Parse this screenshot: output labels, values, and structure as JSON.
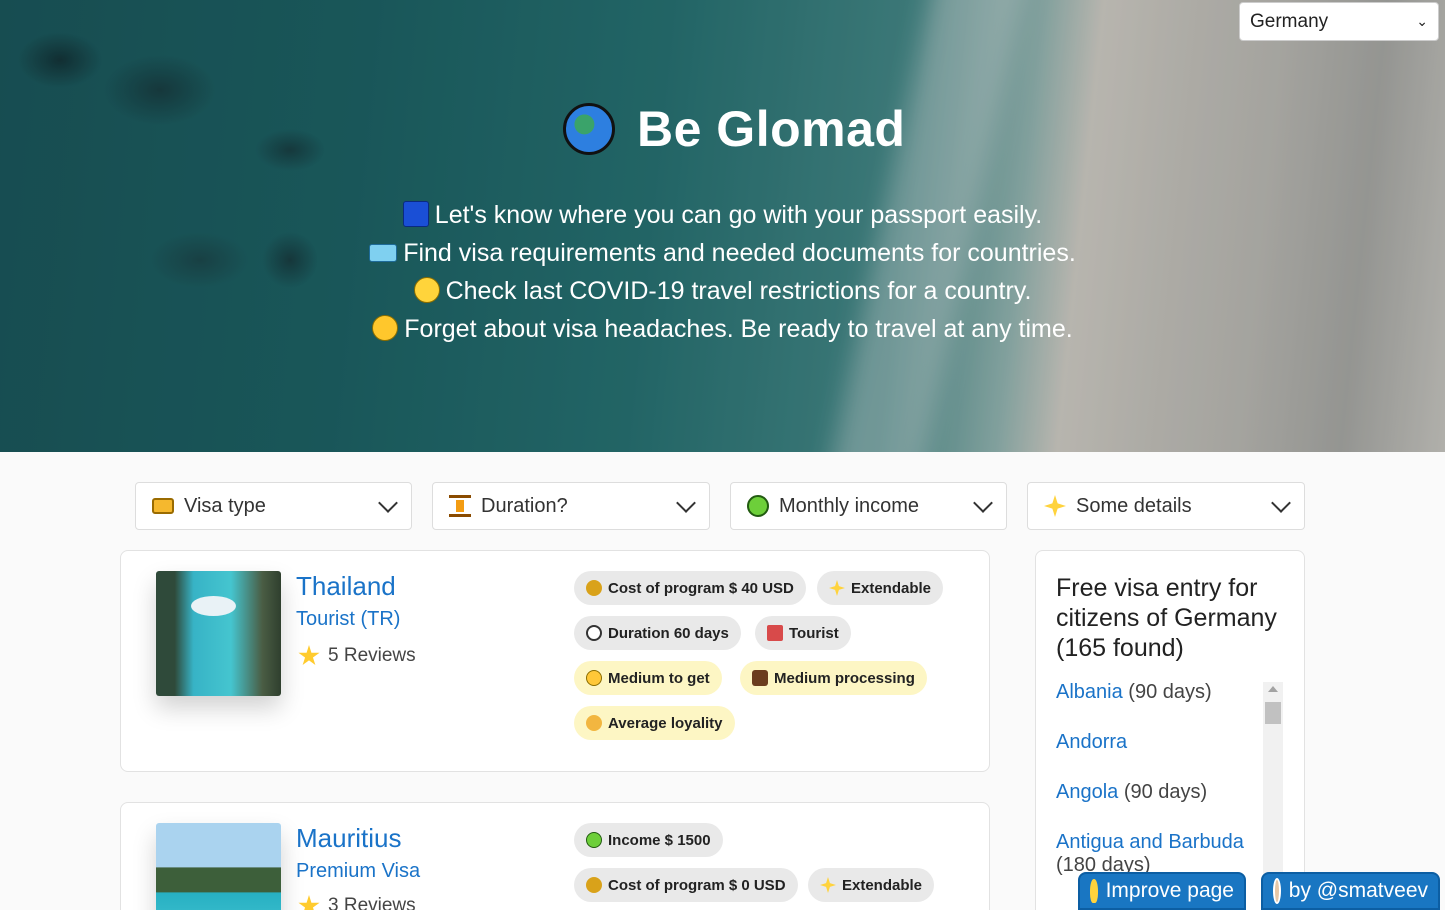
{
  "hero": {
    "title": "Be Glomad",
    "lines": [
      "Let's know where you can go with your passport easily.",
      "Find visa requirements and needed documents for countries.",
      "Check last COVID-19 travel restrictions for a country.",
      "Forget about visa headaches. Be ready to travel at any time."
    ],
    "country_select": {
      "value": "Germany"
    }
  },
  "filters": [
    {
      "label": "Visa type",
      "icon": "credit-card-icon"
    },
    {
      "label": "Duration?",
      "icon": "hourglass-icon"
    },
    {
      "label": "Monthly income",
      "icon": "money-face-icon"
    },
    {
      "label": "Some details",
      "icon": "sparkles-icon"
    }
  ],
  "cards": [
    {
      "country": "Thailand",
      "visa": "Tourist (TR)",
      "reviews": "5 Reviews",
      "tags": [
        "Cost of program $ 40 USD",
        "Extendable",
        "Duration 60 days",
        "Tourist",
        "Medium to get",
        "Medium processing",
        "Average loyality"
      ]
    },
    {
      "country": "Mauritius",
      "visa": "Premium Visa",
      "reviews": "3 Reviews",
      "tags": [
        "Income $ 1500",
        "Cost of program $ 0 USD",
        "Extendable"
      ]
    }
  ],
  "side": {
    "title": "Free visa entry for citizens of Germany (165 found)",
    "items": [
      {
        "name": "Albania",
        "extra": "(90 days)"
      },
      {
        "name": "Andorra",
        "extra": ""
      },
      {
        "name": "Angola",
        "extra": "(90 days)"
      },
      {
        "name": "Antigua and Barbuda",
        "extra": "(180 days)"
      }
    ]
  },
  "buttons": {
    "improve": "Improve page",
    "author": "by @smatveev"
  }
}
